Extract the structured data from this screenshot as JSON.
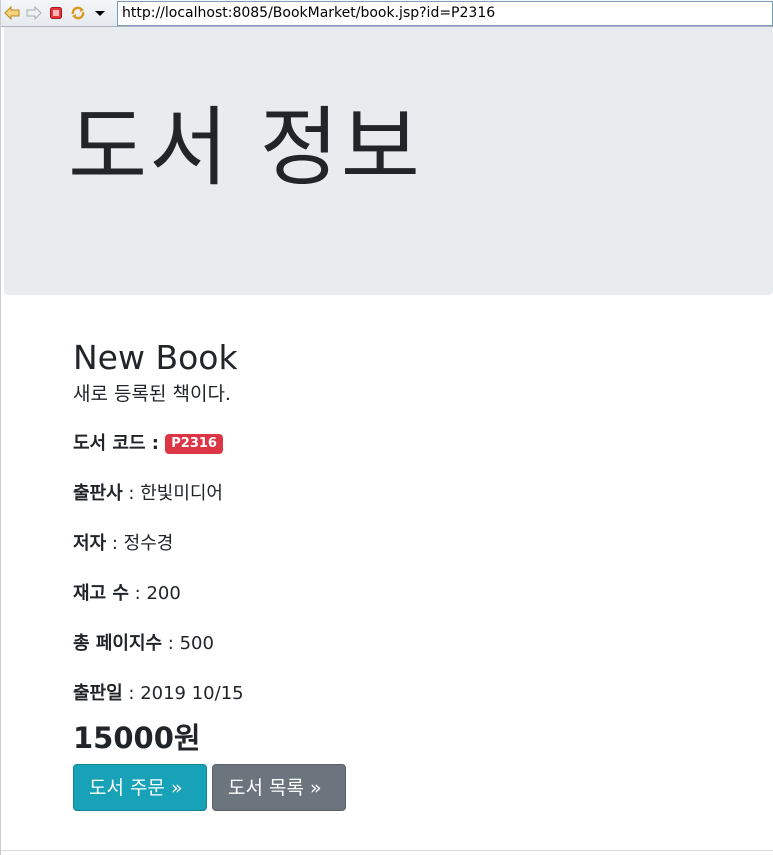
{
  "browser": {
    "url": "http://localhost:8085/BookMarket/book.jsp?id=P2316",
    "icons": [
      "back-arrow-icon",
      "forward-arrow-icon",
      "stop-icon",
      "refresh-icon",
      "dropdown-icon"
    ]
  },
  "header": {
    "title": "도서 정보"
  },
  "book": {
    "name": "New Book",
    "description": "새로 등록된 책이다.",
    "code_label": "도서 코드 : ",
    "code": "P2316",
    "publisher_label": "출판사",
    "publisher": " : 한빛미디어",
    "author_label": "저자",
    "author": " : 정수경",
    "stock_label": "재고 수",
    "stock": " : 200",
    "pages_label": "총 페이지수",
    "pages": " : 500",
    "release_label": "출판일",
    "release": " : 2019 10/15",
    "price": "15000원"
  },
  "actions": {
    "order_label": "도서 주문 »",
    "list_label": "도서 목록 »"
  },
  "colors": {
    "jumbotron_bg": "#e9ecef",
    "badge_bg": "#dc3545",
    "order_btn": "#17a2b8",
    "list_btn": "#6c757d"
  }
}
